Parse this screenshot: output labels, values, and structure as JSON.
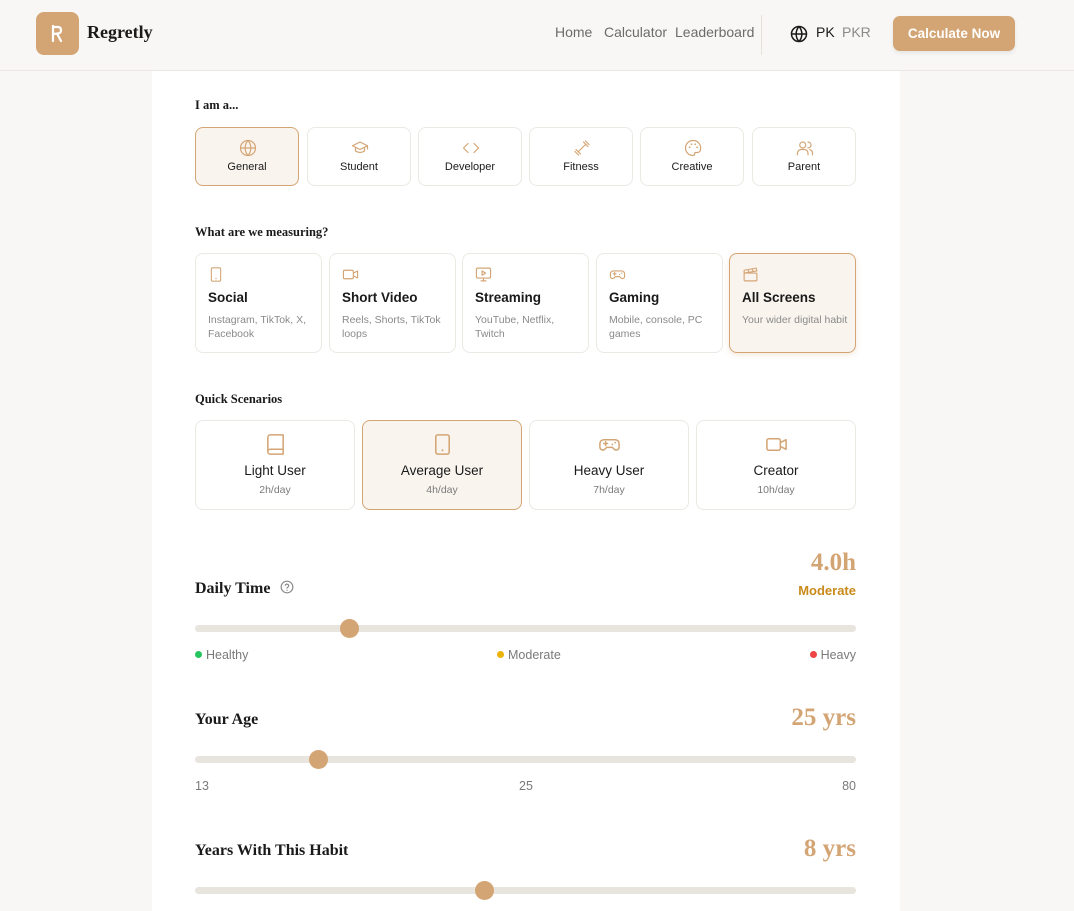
{
  "header": {
    "brand": "Regretly",
    "nav": [
      "Home",
      "Calculator",
      "Leaderboard"
    ],
    "country": "PK",
    "currency": "PKR",
    "cta": "Calculate Now"
  },
  "roles": {
    "label": "I am a...",
    "items": [
      {
        "label": "General",
        "icon": "globe-icon",
        "selected": true
      },
      {
        "label": "Student",
        "icon": "graduation-cap-icon"
      },
      {
        "label": "Developer",
        "icon": "code-icon"
      },
      {
        "label": "Fitness",
        "icon": "dumbbell-icon"
      },
      {
        "label": "Creative",
        "icon": "palette-icon"
      },
      {
        "label": "Parent",
        "icon": "users-icon"
      }
    ]
  },
  "measuring": {
    "label": "What are we measuring?",
    "items": [
      {
        "title": "Social",
        "desc": "Instagram, TikTok, X, Facebook",
        "icon": "smartphone-icon"
      },
      {
        "title": "Short Video",
        "desc": "Reels, Shorts, TikTok loops",
        "icon": "video-icon"
      },
      {
        "title": "Streaming",
        "desc": "YouTube, Netflix, Twitch",
        "icon": "tv-play-icon"
      },
      {
        "title": "Gaming",
        "desc": "Mobile, console, PC games",
        "icon": "gamepad-icon"
      },
      {
        "title": "All Screens",
        "desc": "Your wider digital habit",
        "icon": "clapperboard-icon",
        "selected": true
      }
    ]
  },
  "scenarios": {
    "label": "Quick Scenarios",
    "items": [
      {
        "title": "Light User",
        "sub": "2h/day",
        "icon": "book-icon"
      },
      {
        "title": "Average User",
        "sub": "4h/day",
        "icon": "smartphone-icon",
        "selected": true
      },
      {
        "title": "Heavy User",
        "sub": "7h/day",
        "icon": "gamepad-icon"
      },
      {
        "title": "Creator",
        "sub": "10h/day",
        "icon": "video-icon"
      }
    ]
  },
  "daily": {
    "title": "Daily Time",
    "value": "4.0h",
    "status": "Moderate",
    "fraction": 0.233,
    "legend": [
      "Healthy",
      "Moderate",
      "Heavy"
    ],
    "colors": {
      "healthy": "#22c55e",
      "moderate": "#eab308",
      "heavy": "#ef4444",
      "status": "#c98a1a"
    }
  },
  "age": {
    "title": "Your Age",
    "value": "25 yrs",
    "fraction": 0.187,
    "scale": [
      "13",
      "25",
      "80"
    ]
  },
  "years": {
    "title": "Years With This Habit",
    "value": "8 yrs",
    "fraction": 0.438
  },
  "theme": {
    "accent": "#d4a574",
    "selected_bg": "#faf4ee"
  }
}
